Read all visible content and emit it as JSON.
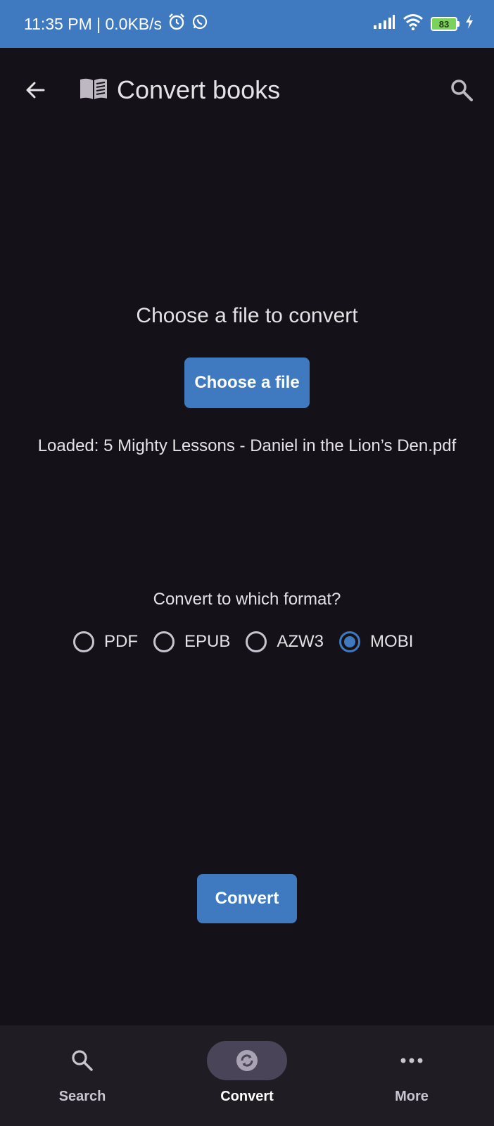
{
  "status_bar": {
    "time_speed": "11:35 PM | 0.0KB/s",
    "battery": "83",
    "icons": [
      "alarm-icon",
      "whatsapp-icon",
      "signal-icon",
      "wifi-icon",
      "battery-icon",
      "charging-icon"
    ]
  },
  "app_bar": {
    "title": "Convert books",
    "icons": [
      "back-arrow-icon",
      "book-icon",
      "search-icon"
    ]
  },
  "main": {
    "heading": "Choose a file to convert",
    "choose_button": "Choose a file",
    "loaded_text": "Loaded: 5 Mighty Lessons - Daniel in the Lion’s Den.pdf",
    "format_question": "Convert to which format?",
    "formats": [
      {
        "label": "PDF",
        "selected": false
      },
      {
        "label": "EPUB",
        "selected": false
      },
      {
        "label": "AZW3",
        "selected": false
      },
      {
        "label": "MOBI",
        "selected": true
      }
    ],
    "convert_button": "Convert"
  },
  "bottom_nav": {
    "items": [
      {
        "label": "Search",
        "icon": "search-icon",
        "active": false
      },
      {
        "label": "Convert",
        "icon": "sync-icon",
        "active": true
      },
      {
        "label": "More",
        "icon": "more-dots-icon",
        "active": false
      }
    ]
  },
  "colors": {
    "accent": "#3f79c0",
    "background": "#141218",
    "nav_background": "#1f1d23",
    "nav_active_pill": "#4a4458"
  }
}
